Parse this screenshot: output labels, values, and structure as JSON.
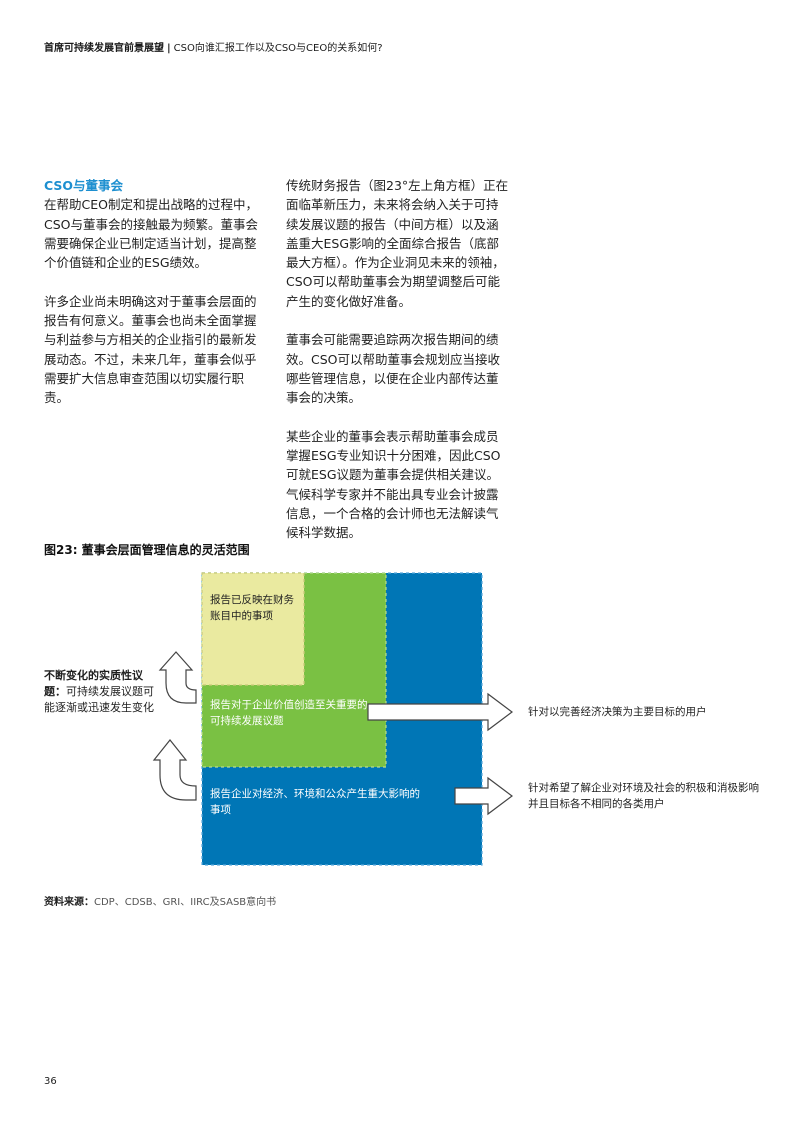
{
  "header": {
    "title_bold": "首席可持续发展官前景展望",
    "separator": "|",
    "subtitle": "CSO向谁汇报工作以及CSO与CEO的关系如何?"
  },
  "left_column": {
    "section_title": "CSO与董事会",
    "paragraphs": [
      "在帮助CEO制定和提出战略的过程中，CSO与董事会的接触最为频繁。董事会需要确保企业已制定适当计划，提高整个价值链和企业的ESG绩效。",
      "许多企业尚未明确这对于董事会层面的报告有何意义。董事会也尚未全面掌握与利益参与方相关的企业指引的最新发展动态。不过，未来几年，董事会似乎需要扩大信息审查范围以切实履行职责。"
    ]
  },
  "right_column": {
    "paragraphs": [
      "传统财务报告（图23°左上角方框）正在面临革新压力，未来将会纳入关于可持续发展议题的报告（中间方框）以及涵盖重大ESG影响的全面综合报告（底部最大方框）。作为企业洞见未来的领袖，CSO可以帮助董事会为期望调整后可能产生的变化做好准备。",
      "董事会可能需要追踪两次报告期间的绩效。CSO可以帮助董事会规划应当接收哪些管理信息，以便在企业内部传达董事会的决策。",
      "某些企业的董事会表示帮助董事会成员掌握ESG专业知识十分困难，因此CSO可就ESG议题为董事会提供相关建议。气候科学专家并不能出具专业会计披露信息，一个合格的会计师也无法解读气候科学数据。"
    ]
  },
  "figure": {
    "title": "图23: 董事会层面管理信息的灵活范围",
    "yellow_box": "报告已反映在财务账目中的事项",
    "green_box": "报告对于企业价值创造至关重要的可持续发展议题",
    "blue_box": "报告企业对经济、环境和公众产生重大影响的事项",
    "side_label_bold": "不断变化的实质性议题：",
    "side_label_rest": "可持续发展议题可能逐渐或迅速发生变化",
    "user_1": "针对以完善经济决策为主要目标的用户",
    "user_2": "针对希望了解企业对环境及社会的积极和消极影响并且目标各不相同的各类用户",
    "colors": {
      "yellow": "#eaeaa0",
      "green": "#7ac143",
      "blue": "#0076b6",
      "title_blue": "#1d8fd0"
    }
  },
  "source": {
    "label": "资料来源：",
    "text": "CDP、CDSB、GRI、IIRC及SASB意向书"
  },
  "page_number": "36"
}
